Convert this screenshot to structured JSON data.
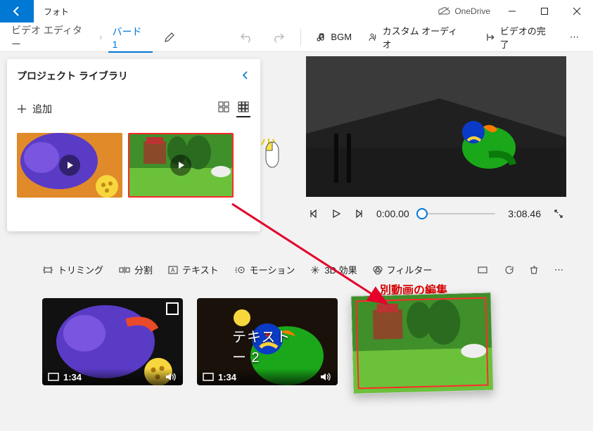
{
  "window": {
    "app_name": "フォト",
    "cloud_label": "OneDrive"
  },
  "breadcrumb": {
    "root": "ビデオ エディター",
    "project": "バード 1"
  },
  "topbar": {
    "bgm": "BGM",
    "custom_audio": "カスタム オーディオ",
    "finish": "ビデオの完了"
  },
  "library": {
    "title": "プロジェクト ライブラリ",
    "add_label": "追加"
  },
  "player": {
    "current_time": "0:00.00",
    "total_time": "3:08.46"
  },
  "tools": {
    "trim": "トリミング",
    "split": "分割",
    "text": "テキスト",
    "motion": "モーション",
    "threed": "3D 効果",
    "filter": "フィルター"
  },
  "clips": [
    {
      "duration": "1:34",
      "text_overlay": ""
    },
    {
      "duration": "1:34",
      "text_overlay": "テキストー 2"
    }
  ],
  "annotation": {
    "label": "別動画の編集"
  }
}
